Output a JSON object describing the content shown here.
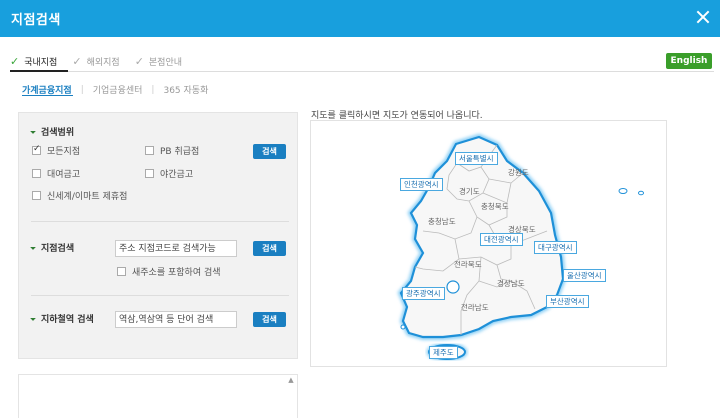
{
  "window": {
    "title": "지점검색"
  },
  "tabs": [
    {
      "label": "국내지점"
    },
    {
      "label": "해외지점"
    },
    {
      "label": "본점안내"
    }
  ],
  "english_button": "English",
  "subtabs": [
    {
      "label": "가계금융지점"
    },
    {
      "label": "기업금융센터"
    },
    {
      "label": "365 자동화"
    }
  ],
  "search": {
    "category_title": "검색범위",
    "options": [
      {
        "label": "모든지점",
        "checked": true
      },
      {
        "label": "PB 취급점",
        "checked": false
      },
      {
        "label": "대여금고",
        "checked": false
      },
      {
        "label": "야간금고",
        "checked": false
      },
      {
        "label": "신세계/이마트 제휴점",
        "checked": false
      }
    ],
    "search_button": "검색",
    "branch_title": "지점검색",
    "branch_placeholder": "주소 지점코드로 검색가능",
    "new_address_label": "새주소를 포함하여 검색",
    "subway_title": "지하철역 검색",
    "subway_placeholder": "역삼,역삼역 등 단어 검색"
  },
  "map": {
    "caption": "지도를 클릭하시면 지도가 연동되어 나옵니다.",
    "cities": [
      "서울특별시",
      "인천광역시",
      "대전광역시",
      "대구광역시",
      "울산광역시",
      "광주광역시",
      "부산광역시",
      "제주도"
    ],
    "provinces": [
      "강원도",
      "경기도",
      "충청북도",
      "충청남도",
      "경상북도",
      "전라북도",
      "경상남도",
      "전라남도"
    ],
    "colors": {
      "outline": "#1e90d8",
      "fill": "#f7f7f7",
      "label": "#1a6fb0"
    }
  }
}
